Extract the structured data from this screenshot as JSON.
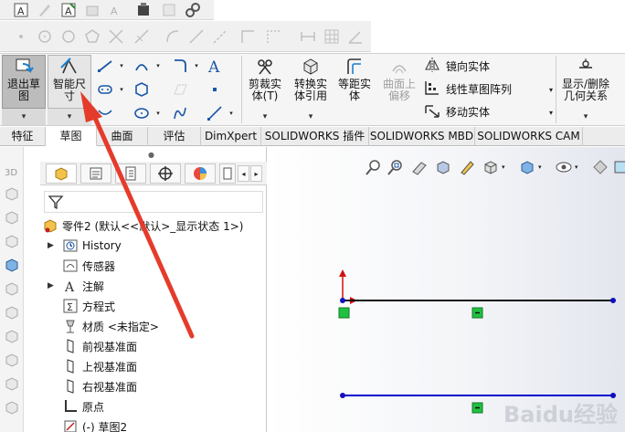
{
  "ribbon": {
    "exit_sketch": [
      "退出草",
      "图"
    ],
    "smart_dimension": [
      "智能尺",
      "寸"
    ],
    "trim": [
      "剪裁实",
      "体(T)"
    ],
    "convert": [
      "转换实",
      "体引用"
    ],
    "offset": [
      "等距实",
      "体"
    ],
    "surface_offset": [
      "曲面上",
      "偏移"
    ],
    "mirror": "镜向实体",
    "linear_pattern": "线性草图阵列",
    "move": "移动实体",
    "display_delete": [
      "显示/删除",
      "几何关系"
    ]
  },
  "tabs": [
    "特征",
    "草图",
    "曲面",
    "评估",
    "DimXpert",
    "SOLIDWORKS 插件",
    "SOLIDWORKS MBD",
    "SOLIDWORKS CAM"
  ],
  "active_tab": "草图",
  "tree": {
    "part": "零件2 (默认<<默认>_显示状态 1>)",
    "items": [
      "History",
      "传感器",
      "注解",
      "方程式",
      "材质 <未指定>",
      "前视基准面",
      "上视基准面",
      "右视基准面",
      "原点",
      "(-) 草图2"
    ]
  },
  "watermark": "Baidu经验",
  "colors": {
    "accent_red": "#e53b2b",
    "sketch_blue": "#0000cc",
    "tab_active": "#ffffff",
    "relation_green": "#20c040"
  }
}
